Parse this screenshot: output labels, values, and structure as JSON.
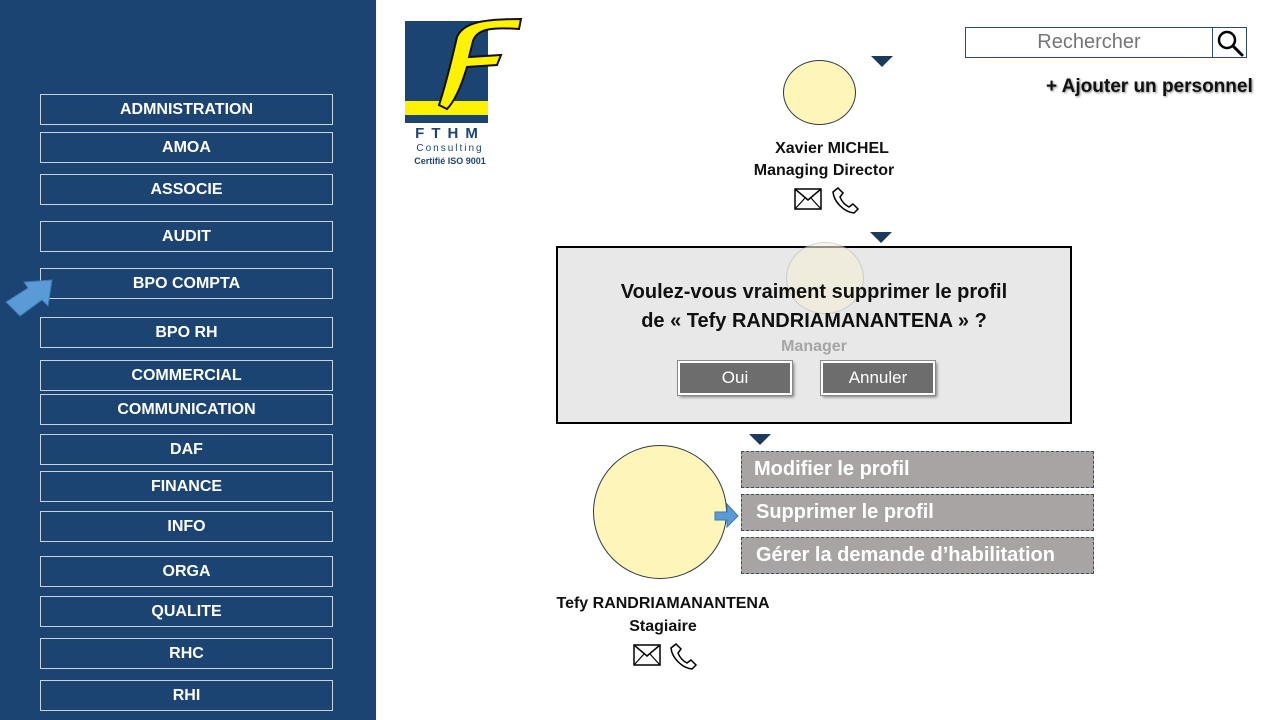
{
  "sidebar": {
    "items": [
      {
        "label": "ADMNISTRATION"
      },
      {
        "label": "AMOA"
      },
      {
        "label": "ASSOCIE"
      },
      {
        "label": "AUDIT"
      },
      {
        "label": "BPO COMPTA"
      },
      {
        "label": "BPO RH"
      },
      {
        "label": "COMMERCIAL"
      },
      {
        "label": "COMMUNICATION"
      },
      {
        "label": "DAF"
      },
      {
        "label": "FINANCE"
      },
      {
        "label": "INFO"
      },
      {
        "label": "ORGA"
      },
      {
        "label": "QUALITE"
      },
      {
        "label": "RHC"
      },
      {
        "label": "RHI"
      }
    ]
  },
  "logo": {
    "letter": "F",
    "name": "FTHM",
    "sub": "Consulting",
    "cert": "Certifié ISO 9001"
  },
  "search": {
    "placeholder": "Rechercher"
  },
  "add_person": "+ Ajouter un personnel",
  "org": {
    "top": {
      "name": "Xavier MICHEL",
      "role": "Managing Director"
    },
    "middle": {
      "role": "Manager"
    },
    "selected": {
      "name": "Tefy RANDRIAMANANTENA",
      "role": "Stagiaire"
    }
  },
  "context_menu": {
    "items": [
      {
        "label": "Modifier le profil"
      },
      {
        "label": "Supprimer le profil"
      },
      {
        "label": "Gérer la demande d’habilitation"
      }
    ]
  },
  "modal": {
    "line1": "Voulez-vous vraiment supprimer le profil",
    "line2": "de « Tefy RANDRIAMANANTENA » ?",
    "ok": "Oui",
    "cancel": "Annuler"
  },
  "colors": {
    "sidebar": "#1b4473",
    "avatar": "#fef6b8",
    "menu": "#a8a4a4",
    "button": "#6d6d6d"
  }
}
